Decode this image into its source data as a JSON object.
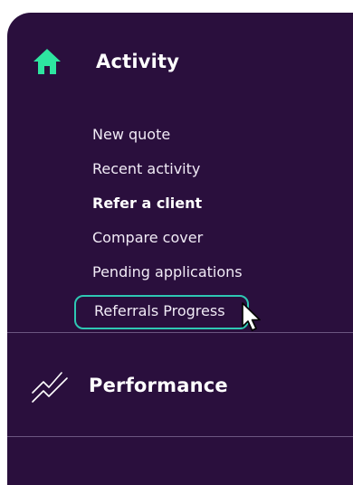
{
  "sections": {
    "activity": {
      "title": "Activity",
      "icon": "home-icon",
      "items": [
        {
          "label": "New quote"
        },
        {
          "label": "Recent activity"
        },
        {
          "label": "Refer a client"
        },
        {
          "label": "Compare cover"
        },
        {
          "label": "Pending applications"
        },
        {
          "label": "Referrals Progress"
        }
      ]
    },
    "performance": {
      "title": "Performance",
      "icon": "trend-chart-icon"
    }
  },
  "colors": {
    "panel_bg": "#2a0f3d",
    "accent_green": "#2ee5a0",
    "highlight_border": "#2ec7b3",
    "text": "#ffffff"
  }
}
